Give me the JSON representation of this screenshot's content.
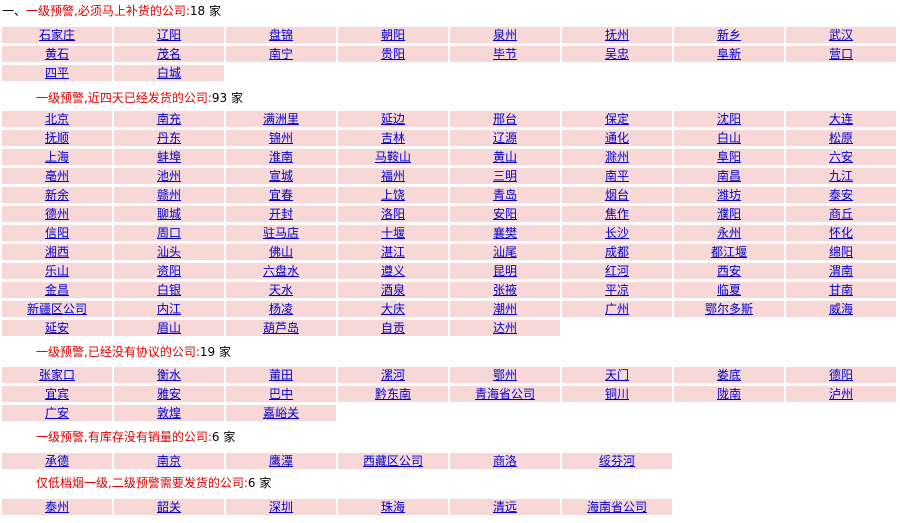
{
  "sections": [
    {
      "prefix": "一、",
      "title": "一级预警,必须马上补货的公司:",
      "count": "18",
      "unit": "家",
      "cities": [
        "石家庄",
        "辽阳",
        "盘锦",
        "朝阳",
        "泉州",
        "抚州",
        "新乡",
        "武汉",
        "黄石",
        "茂名",
        "南宁",
        "贵阳",
        "毕节",
        "吴忠",
        "阜新",
        "营口",
        "四平",
        "白城"
      ]
    },
    {
      "prefix": "",
      "title": "一级预警,近四天已经发货的公司:",
      "count": "93",
      "unit": "家",
      "cities": [
        "北京",
        "南充",
        "满洲里",
        "延边",
        "邢台",
        "保定",
        "沈阳",
        "大连",
        "抚顺",
        "丹东",
        "锦州",
        "吉林",
        "辽源",
        "通化",
        "白山",
        "松原",
        "上海",
        "蚌埠",
        "淮南",
        "马鞍山",
        "黄山",
        "滁州",
        "阜阳",
        "六安",
        "亳州",
        "池州",
        "宣城",
        "福州",
        "三明",
        "南平",
        "南昌",
        "九江",
        "新余",
        "赣州",
        "宜春",
        "上饶",
        "青岛",
        "烟台",
        "潍坊",
        "泰安",
        "德州",
        "聊城",
        "开封",
        "洛阳",
        "安阳",
        "焦作",
        "濮阳",
        "商丘",
        "信阳",
        "周口",
        "驻马店",
        "十堰",
        "襄樊",
        "长沙",
        "永州",
        "怀化",
        "湘西",
        "汕头",
        "佛山",
        "湛江",
        "汕尾",
        "成都",
        "都江堰",
        "绵阳",
        "乐山",
        "资阳",
        "六盘水",
        "遵义",
        "昆明",
        "红河",
        "西安",
        "渭南",
        "金昌",
        "白银",
        "天水",
        "酒泉",
        "张掖",
        "平凉",
        "临夏",
        "甘南",
        "新疆区公司",
        "内江",
        "杨凌",
        "大庆",
        "潮州",
        "广州",
        "鄂尔多斯",
        "威海",
        "延安",
        "眉山",
        "葫芦岛",
        "自贡",
        "达州"
      ]
    },
    {
      "prefix": "",
      "title": "一级预警,已经没有协议的公司:",
      "count": "19",
      "unit": "家",
      "cities": [
        "张家口",
        "衡水",
        "莆田",
        "漯河",
        "鄂州",
        "天门",
        "娄底",
        "德阳",
        "宜宾",
        "雅安",
        "巴中",
        "黔东南",
        "青海省公司",
        "铜川",
        "陇南",
        "泸州",
        "广安",
        "敦煌",
        "嘉峪关"
      ]
    },
    {
      "prefix": "",
      "title": "一级预警,有库存没有销量的公司:",
      "count": "6",
      "unit": "家",
      "cities": [
        "承德",
        "南京",
        "鹰潭",
        "西藏区公司",
        "商洛",
        "绥芬河"
      ]
    },
    {
      "prefix": "",
      "title": "仅低档烟一级,二级预警需要发货的公司:",
      "count": "6",
      "unit": "家",
      "cities": [
        "泰州",
        "韶关",
        "深圳",
        "珠海",
        "清远",
        "海南省公司"
      ]
    }
  ]
}
